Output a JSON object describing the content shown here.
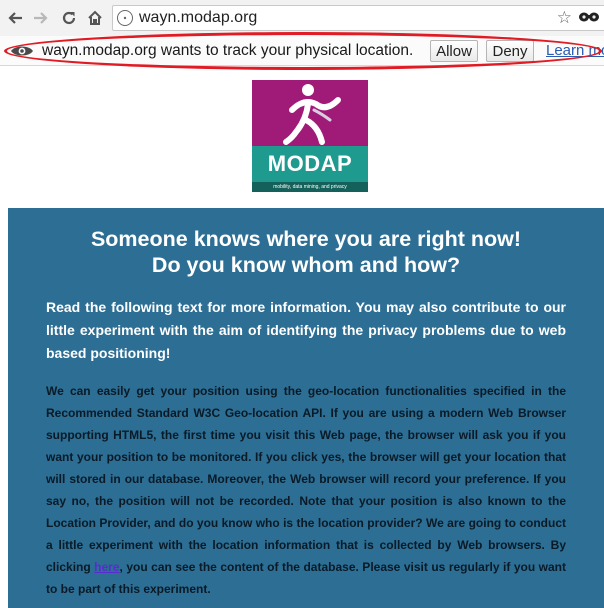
{
  "browser": {
    "back_icon": "back-arrow-icon",
    "forward_icon": "forward-arrow-icon",
    "reload_icon": "reload-icon",
    "home_icon": "home-icon",
    "url": "wayn.modap.org",
    "bookmark_icon": "star-icon",
    "extension_icon": "mask-icon"
  },
  "infobar": {
    "message": "wayn.modap.org wants to track your physical location.",
    "allow_label": "Allow",
    "deny_label": "Deny",
    "learn_label": "Learn more",
    "highlight_color": "#e01b24"
  },
  "logo": {
    "name": "MODAP",
    "tagline": "mobility, data mining, and privacy",
    "colors": {
      "magenta": "#a01a78",
      "teal": "#1f9a8f"
    }
  },
  "main": {
    "background": "#2c6e94",
    "headline_1": "Someone knows where you are right now!",
    "headline_2": "Do you know whom and how?",
    "intro": "Read the following text for more information. You may also contribute to our little experiment with the aim of identifying the privacy problems due to web based positioning!",
    "body_before_link": "We can easily get your position using the geo-location functionalities specified in the Recommended Standard W3C Geo-location API. If you are using a modern Web Browser supporting HTML5, the first time you visit this Web page, the browser will ask you if you want your position to be monitored. If you click yes, the browser will get your location that will stored in our database. Moreover, the Web browser will record your preference. If you say no, the position will not be recorded. Note that your position is also known to the Location Provider, and do you know who is the location provider? We are going to conduct a little experiment with the location information that is collected by Web browsers. By clicking ",
    "link_text": "here",
    "body_after_link": ", you can see the content of the database. Please visit us regularly if you want to be part of this experiment."
  }
}
